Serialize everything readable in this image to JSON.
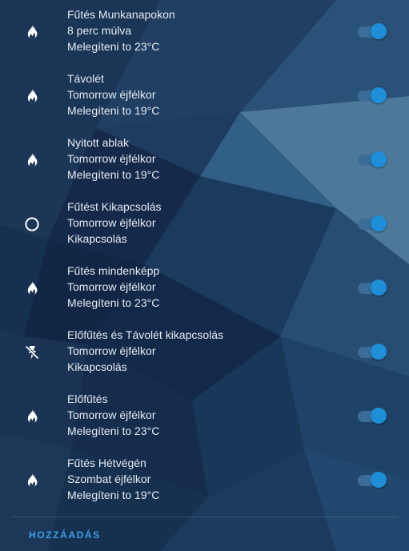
{
  "schedules": [
    {
      "name": "Fűtés Munkanapokon",
      "when": "8 perc múlva",
      "action": "Melegíteni to 23°C",
      "icon": "fire-icon",
      "enabled": true
    },
    {
      "name": "Távolét",
      "when": "Tomorrow éjfélkor",
      "action": "Melegíteni to 19°C",
      "icon": "fire-icon",
      "enabled": true
    },
    {
      "name": "Nyitott ablak",
      "when": "Tomorrow éjfélkor",
      "action": "Melegíteni to 19°C",
      "icon": "fire-icon",
      "enabled": true
    },
    {
      "name": "Fűtést Kikapcsolás",
      "when": "Tomorrow éjfélkor",
      "action": "Kikapcsolás",
      "icon": "circle-off-icon",
      "enabled": true
    },
    {
      "name": "Fűtés mindenképp",
      "when": "Tomorrow éjfélkor",
      "action": "Melegíteni to 23°C",
      "icon": "fire-icon",
      "enabled": true
    },
    {
      "name": "Előfűtés és Távolét kikapcsolás",
      "when": "Tomorrow éjfélkor",
      "action": "Kikapcsolás",
      "icon": "flash-off-icon",
      "enabled": true
    },
    {
      "name": "Előfűtés",
      "when": "Tomorrow éjfélkor",
      "action": "Melegíteni to 23°C",
      "icon": "fire-icon",
      "enabled": true
    },
    {
      "name": "Fűtés Hétvégén",
      "when": "Szombat éjfélkor",
      "action": "Melegíteni to 19°C",
      "icon": "fire-icon",
      "enabled": true
    }
  ],
  "add_button": "HOZZÁADÁS",
  "colors": {
    "accent": "#1e8ed8",
    "toggle_track": "#3a6d98",
    "text": "#e6ecf3",
    "background": "#16304f"
  }
}
